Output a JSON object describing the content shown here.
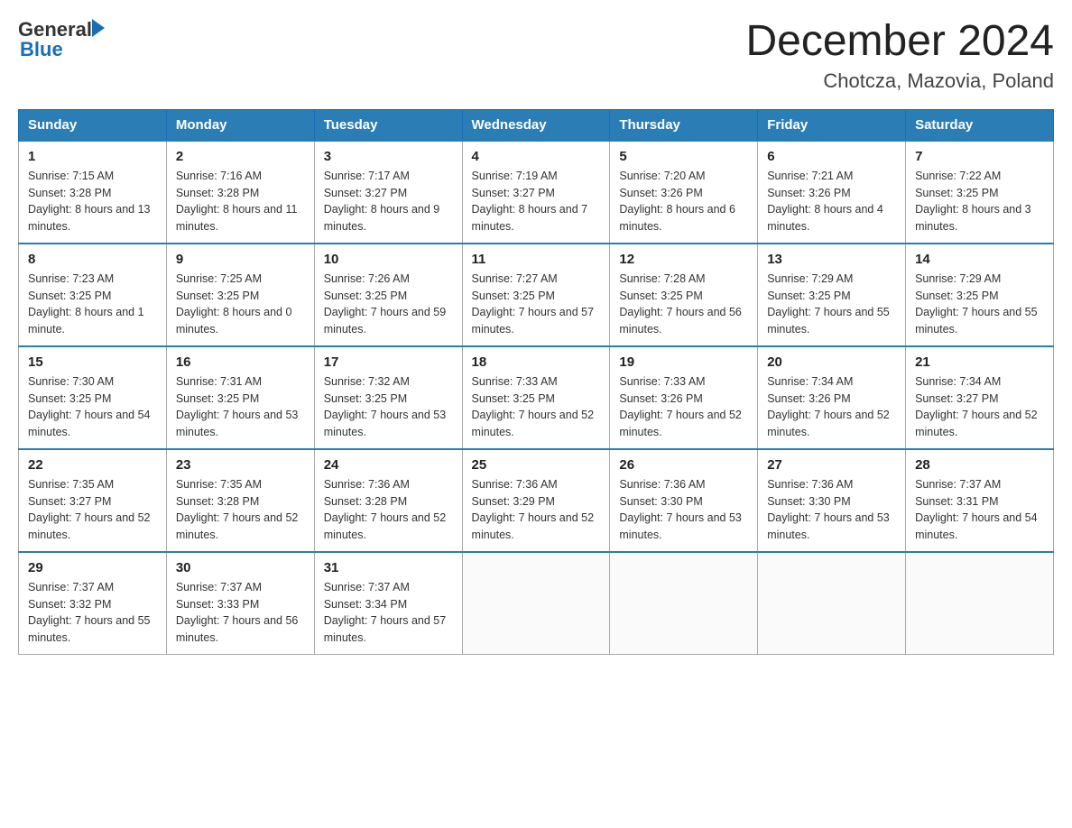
{
  "header": {
    "logo_general": "General",
    "logo_blue": "Blue",
    "title": "December 2024",
    "location": "Chotcza, Mazovia, Poland"
  },
  "weekdays": [
    "Sunday",
    "Monday",
    "Tuesday",
    "Wednesday",
    "Thursday",
    "Friday",
    "Saturday"
  ],
  "weeks": [
    [
      {
        "day": "1",
        "sunrise": "7:15 AM",
        "sunset": "3:28 PM",
        "daylight": "8 hours and 13 minutes."
      },
      {
        "day": "2",
        "sunrise": "7:16 AM",
        "sunset": "3:28 PM",
        "daylight": "8 hours and 11 minutes."
      },
      {
        "day": "3",
        "sunrise": "7:17 AM",
        "sunset": "3:27 PM",
        "daylight": "8 hours and 9 minutes."
      },
      {
        "day": "4",
        "sunrise": "7:19 AM",
        "sunset": "3:27 PM",
        "daylight": "8 hours and 7 minutes."
      },
      {
        "day": "5",
        "sunrise": "7:20 AM",
        "sunset": "3:26 PM",
        "daylight": "8 hours and 6 minutes."
      },
      {
        "day": "6",
        "sunrise": "7:21 AM",
        "sunset": "3:26 PM",
        "daylight": "8 hours and 4 minutes."
      },
      {
        "day": "7",
        "sunrise": "7:22 AM",
        "sunset": "3:25 PM",
        "daylight": "8 hours and 3 minutes."
      }
    ],
    [
      {
        "day": "8",
        "sunrise": "7:23 AM",
        "sunset": "3:25 PM",
        "daylight": "8 hours and 1 minute."
      },
      {
        "day": "9",
        "sunrise": "7:25 AM",
        "sunset": "3:25 PM",
        "daylight": "8 hours and 0 minutes."
      },
      {
        "day": "10",
        "sunrise": "7:26 AM",
        "sunset": "3:25 PM",
        "daylight": "7 hours and 59 minutes."
      },
      {
        "day": "11",
        "sunrise": "7:27 AM",
        "sunset": "3:25 PM",
        "daylight": "7 hours and 57 minutes."
      },
      {
        "day": "12",
        "sunrise": "7:28 AM",
        "sunset": "3:25 PM",
        "daylight": "7 hours and 56 minutes."
      },
      {
        "day": "13",
        "sunrise": "7:29 AM",
        "sunset": "3:25 PM",
        "daylight": "7 hours and 55 minutes."
      },
      {
        "day": "14",
        "sunrise": "7:29 AM",
        "sunset": "3:25 PM",
        "daylight": "7 hours and 55 minutes."
      }
    ],
    [
      {
        "day": "15",
        "sunrise": "7:30 AM",
        "sunset": "3:25 PM",
        "daylight": "7 hours and 54 minutes."
      },
      {
        "day": "16",
        "sunrise": "7:31 AM",
        "sunset": "3:25 PM",
        "daylight": "7 hours and 53 minutes."
      },
      {
        "day": "17",
        "sunrise": "7:32 AM",
        "sunset": "3:25 PM",
        "daylight": "7 hours and 53 minutes."
      },
      {
        "day": "18",
        "sunrise": "7:33 AM",
        "sunset": "3:25 PM",
        "daylight": "7 hours and 52 minutes."
      },
      {
        "day": "19",
        "sunrise": "7:33 AM",
        "sunset": "3:26 PM",
        "daylight": "7 hours and 52 minutes."
      },
      {
        "day": "20",
        "sunrise": "7:34 AM",
        "sunset": "3:26 PM",
        "daylight": "7 hours and 52 minutes."
      },
      {
        "day": "21",
        "sunrise": "7:34 AM",
        "sunset": "3:27 PM",
        "daylight": "7 hours and 52 minutes."
      }
    ],
    [
      {
        "day": "22",
        "sunrise": "7:35 AM",
        "sunset": "3:27 PM",
        "daylight": "7 hours and 52 minutes."
      },
      {
        "day": "23",
        "sunrise": "7:35 AM",
        "sunset": "3:28 PM",
        "daylight": "7 hours and 52 minutes."
      },
      {
        "day": "24",
        "sunrise": "7:36 AM",
        "sunset": "3:28 PM",
        "daylight": "7 hours and 52 minutes."
      },
      {
        "day": "25",
        "sunrise": "7:36 AM",
        "sunset": "3:29 PM",
        "daylight": "7 hours and 52 minutes."
      },
      {
        "day": "26",
        "sunrise": "7:36 AM",
        "sunset": "3:30 PM",
        "daylight": "7 hours and 53 minutes."
      },
      {
        "day": "27",
        "sunrise": "7:36 AM",
        "sunset": "3:30 PM",
        "daylight": "7 hours and 53 minutes."
      },
      {
        "day": "28",
        "sunrise": "7:37 AM",
        "sunset": "3:31 PM",
        "daylight": "7 hours and 54 minutes."
      }
    ],
    [
      {
        "day": "29",
        "sunrise": "7:37 AM",
        "sunset": "3:32 PM",
        "daylight": "7 hours and 55 minutes."
      },
      {
        "day": "30",
        "sunrise": "7:37 AM",
        "sunset": "3:33 PM",
        "daylight": "7 hours and 56 minutes."
      },
      {
        "day": "31",
        "sunrise": "7:37 AM",
        "sunset": "3:34 PM",
        "daylight": "7 hours and 57 minutes."
      },
      null,
      null,
      null,
      null
    ]
  ]
}
